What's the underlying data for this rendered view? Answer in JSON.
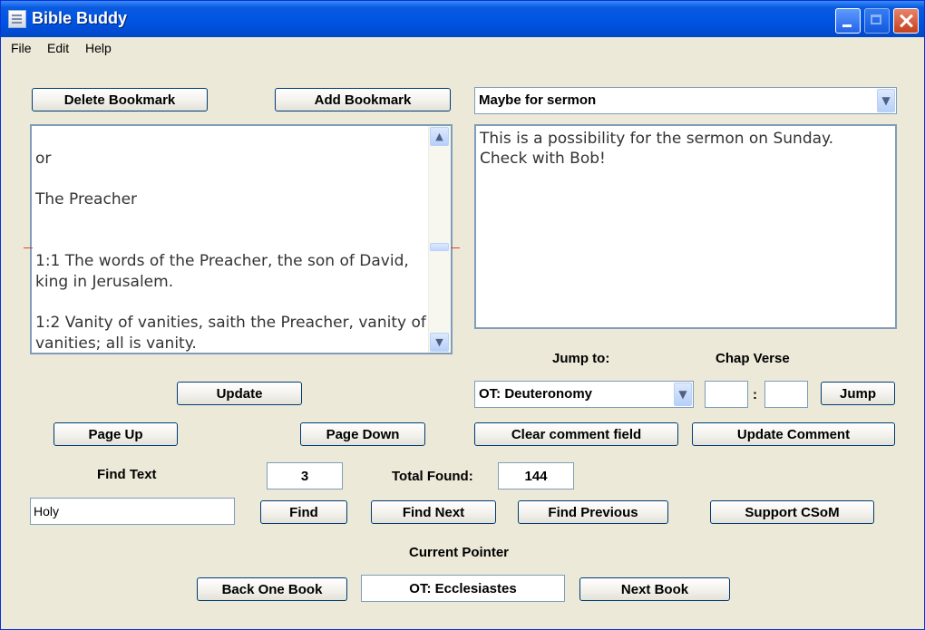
{
  "window": {
    "title": "Bible Buddy"
  },
  "menu": [
    "File",
    "Edit",
    "Help"
  ],
  "bookmarks": {
    "delete_label": "Delete Bookmark",
    "add_label": "Add Bookmark",
    "selected": "Maybe for sermon"
  },
  "text_panel": {
    "lines": [
      "or",
      "The Preacher",
      "1:1 The words of the Preacher, the son of David, king in Jerusalem.",
      "1:2 Vanity of vanities, saith the Preacher, vanity of vanities; all is vanity."
    ]
  },
  "comment": {
    "text": "This is a possibility for the sermon on Sunday.\nCheck with Bob!"
  },
  "jump": {
    "jump_to_label": "Jump to:",
    "chap_verse_label": "Chap  Verse",
    "book_selected": "OT: Deuteronomy",
    "chapter": "",
    "separator": ":",
    "verse": "",
    "jump_label": "Jump"
  },
  "buttons": {
    "update": "Update",
    "page_up": "Page Up",
    "page_down": "Page Down",
    "clear_comment": "Clear comment field",
    "update_comment": "Update Comment",
    "find": "Find",
    "find_next": "Find Next",
    "find_previous": "Find Previous",
    "support": "Support CSoM",
    "back_one_book": "Back One Book",
    "next_book": "Next Book"
  },
  "find": {
    "label": "Find Text",
    "count": "3",
    "total_label": "Total Found:",
    "total": "144",
    "query": "Holy"
  },
  "pointer": {
    "label": "Current Pointer",
    "value": "OT: Ecclesiastes"
  }
}
